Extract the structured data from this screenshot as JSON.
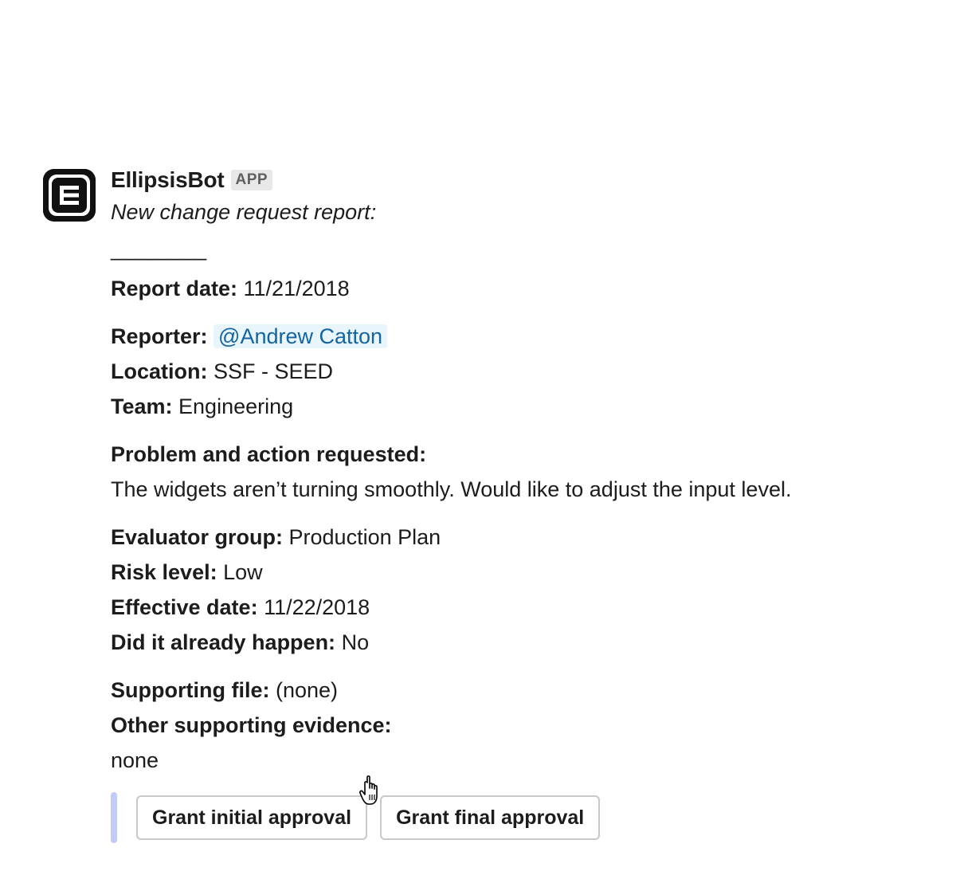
{
  "message": {
    "sender": "EllipsisBot",
    "badge": "APP",
    "avatar_icon": "ellipsis-logo-icon",
    "intro": "New change request report:",
    "divider": "________",
    "fields": {
      "report_date": {
        "label": "Report date:",
        "value": " 11/21/2018"
      },
      "reporter": {
        "label": "Reporter:",
        "value": "@Andrew Catton"
      },
      "location": {
        "label": "Location:",
        "value": " SSF - SEED"
      },
      "team": {
        "label": "Team:",
        "value": " Engineering"
      },
      "problem": {
        "label": "Problem and action requested:",
        "value": "The widgets aren’t turning smoothly. Would like to adjust the input level."
      },
      "evaluator_group": {
        "label": "Evaluator group:",
        "value": " Production Plan"
      },
      "risk_level": {
        "label": "Risk level:",
        "value": " Low"
      },
      "effective_date": {
        "label": "Effective date:",
        "value": " 11/22/2018"
      },
      "already_happened": {
        "label": "Did it already happen:",
        "value": " No"
      },
      "supporting_file": {
        "label": "Supporting file:",
        "value": " (none)"
      },
      "other_evidence": {
        "label": "Other supporting evidence:",
        "value": "none"
      }
    },
    "actions": {
      "initial_label": "Grant initial approval",
      "final_label": "Grant final approval"
    }
  },
  "colors": {
    "mention_bg": "#e8f5fa",
    "mention_text": "#1264a3",
    "attachment_bar": "#c3ccf6",
    "text": "#1d1c1d"
  }
}
